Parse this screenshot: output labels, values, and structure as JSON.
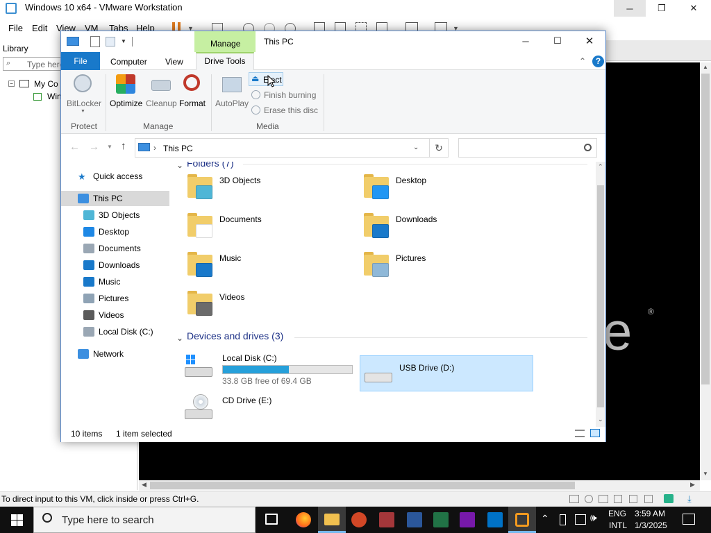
{
  "vmware": {
    "title": "Windows 10 x64 - VMware Workstation",
    "menu": [
      "File",
      "Edit",
      "View",
      "VM",
      "Tabs",
      "Help"
    ],
    "library": {
      "label": "Library",
      "search_placeholder": "Type here",
      "tree": [
        "My Co",
        "Win"
      ]
    },
    "status": "To direct input to this VM, click inside or press Ctrl+G."
  },
  "explorer": {
    "title": "This PC",
    "context_tab": "Manage",
    "tabs": [
      "File",
      "Computer",
      "View",
      "Drive Tools"
    ],
    "ribbon": {
      "protect": {
        "group": "Protect",
        "bitlocker": "BitLocker"
      },
      "manage": {
        "group": "Manage",
        "optimize": "Optimize",
        "cleanup": "Cleanup",
        "format": "Format"
      },
      "media": {
        "group": "Media",
        "autoplay": "AutoPlay",
        "eject": "Eject",
        "finish_burning": "Finish burning",
        "erase": "Erase this disc"
      }
    },
    "address": {
      "crumb": "This PC",
      "search_placeholder": ""
    },
    "nav": [
      {
        "label": "Quick access",
        "icon": "star-icon",
        "indent": 0,
        "selected": false
      },
      {
        "label": "This PC",
        "icon": "computer-icon",
        "indent": 0,
        "selected": true
      },
      {
        "label": "3D Objects",
        "icon": "3d-objects-icon",
        "indent": 1,
        "selected": false
      },
      {
        "label": "Desktop",
        "icon": "desktop-icon",
        "indent": 1,
        "selected": false
      },
      {
        "label": "Documents",
        "icon": "documents-icon",
        "indent": 1,
        "selected": false
      },
      {
        "label": "Downloads",
        "icon": "downloads-icon",
        "indent": 1,
        "selected": false
      },
      {
        "label": "Music",
        "icon": "music-icon",
        "indent": 1,
        "selected": false
      },
      {
        "label": "Pictures",
        "icon": "pictures-icon",
        "indent": 1,
        "selected": false
      },
      {
        "label": "Videos",
        "icon": "videos-icon",
        "indent": 1,
        "selected": false
      },
      {
        "label": "Local Disk (C:)",
        "icon": "local-disk-icon",
        "indent": 1,
        "selected": false
      },
      {
        "label": "Network",
        "icon": "network-icon",
        "indent": 0,
        "selected": false
      }
    ],
    "folders_header": "Folders (7)",
    "folders": [
      "3D Objects",
      "Desktop",
      "Documents",
      "Downloads",
      "Music",
      "Pictures",
      "Videos"
    ],
    "drives_header": "Devices and drives (3)",
    "drives": [
      {
        "name": "Local Disk (C:)",
        "free": "33.8 GB free of 69.4 GB",
        "used_fraction": 0.513
      },
      {
        "name": "USB Drive (D:)",
        "selected": true
      },
      {
        "name": "CD Drive (E:)"
      }
    ],
    "status": {
      "items": "10 items",
      "selected": "1 item selected"
    }
  },
  "taskbar": {
    "search_placeholder": "Type here to search",
    "lang1": "ENG",
    "lang2": "INTL",
    "time": "3:59 AM",
    "date": "1/3/2025"
  },
  "colors": {
    "selection": "#cce8ff",
    "accent": "#1979ca",
    "diskbar": "#26a0da"
  }
}
